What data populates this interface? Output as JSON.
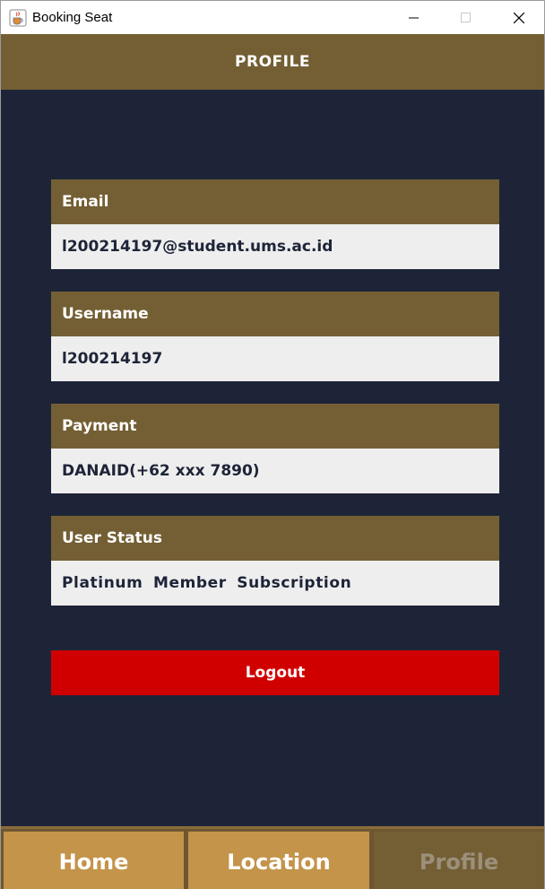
{
  "window": {
    "title": "Booking Seat",
    "icon": "java-cup-icon"
  },
  "header": {
    "title": "PROFILE"
  },
  "fields": [
    {
      "label": "Email",
      "value": "l200214197@student.ums.ac.id"
    },
    {
      "label": "Username",
      "value": "l200214197"
    },
    {
      "label": "Payment",
      "value": "DANAID(+62 xxx 7890)"
    },
    {
      "label": "User Status",
      "value": "Platinum Member Subscription"
    }
  ],
  "logout": {
    "label": "Logout"
  },
  "nav": {
    "home": "Home",
    "location": "Location",
    "profile": "Profile",
    "active": "Profile"
  },
  "colors": {
    "background": "#1e2438",
    "header": "#745f34",
    "nav_button": "#c3944a",
    "field_value_bg": "#eeeeee",
    "logout": "#d10000"
  }
}
